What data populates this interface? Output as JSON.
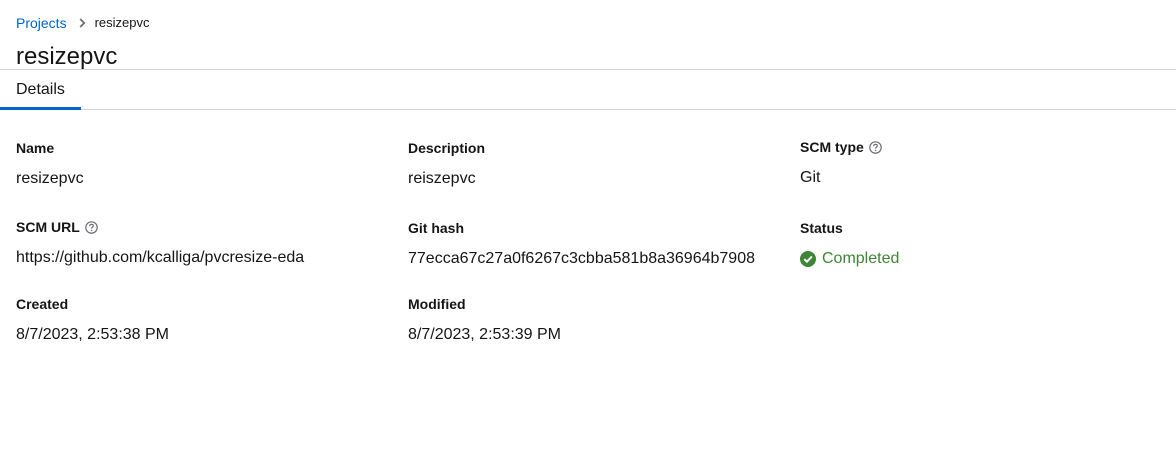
{
  "breadcrumb": {
    "parent": "Projects",
    "current": "resizepvc"
  },
  "page": {
    "title": "resizepvc"
  },
  "tabs": [
    {
      "label": "Details"
    }
  ],
  "fields": {
    "name": {
      "label": "Name",
      "value": "resizepvc"
    },
    "description": {
      "label": "Description",
      "value": "reiszepvc"
    },
    "scm_type": {
      "label": "SCM type",
      "value": "Git"
    },
    "scm_url": {
      "label": "SCM URL",
      "value": "https://github.com/kcalliga/pvcresize-eda"
    },
    "git_hash": {
      "label": "Git hash",
      "value": "77ecca67c27a0f6267c3cbba581b8a36964b7908"
    },
    "status": {
      "label": "Status",
      "value": "Completed"
    },
    "created": {
      "label": "Created",
      "value": "8/7/2023, 2:53:38 PM"
    },
    "modified": {
      "label": "Modified",
      "value": "8/7/2023, 2:53:39 PM"
    }
  },
  "colors": {
    "link": "#0066cc",
    "success": "#3e8635",
    "text": "#151515",
    "border": "#d2d2d2"
  },
  "icons": {
    "breadcrumb_separator": "chevron-right-icon",
    "help": "question-circle-icon",
    "status": "check-circle-icon"
  }
}
